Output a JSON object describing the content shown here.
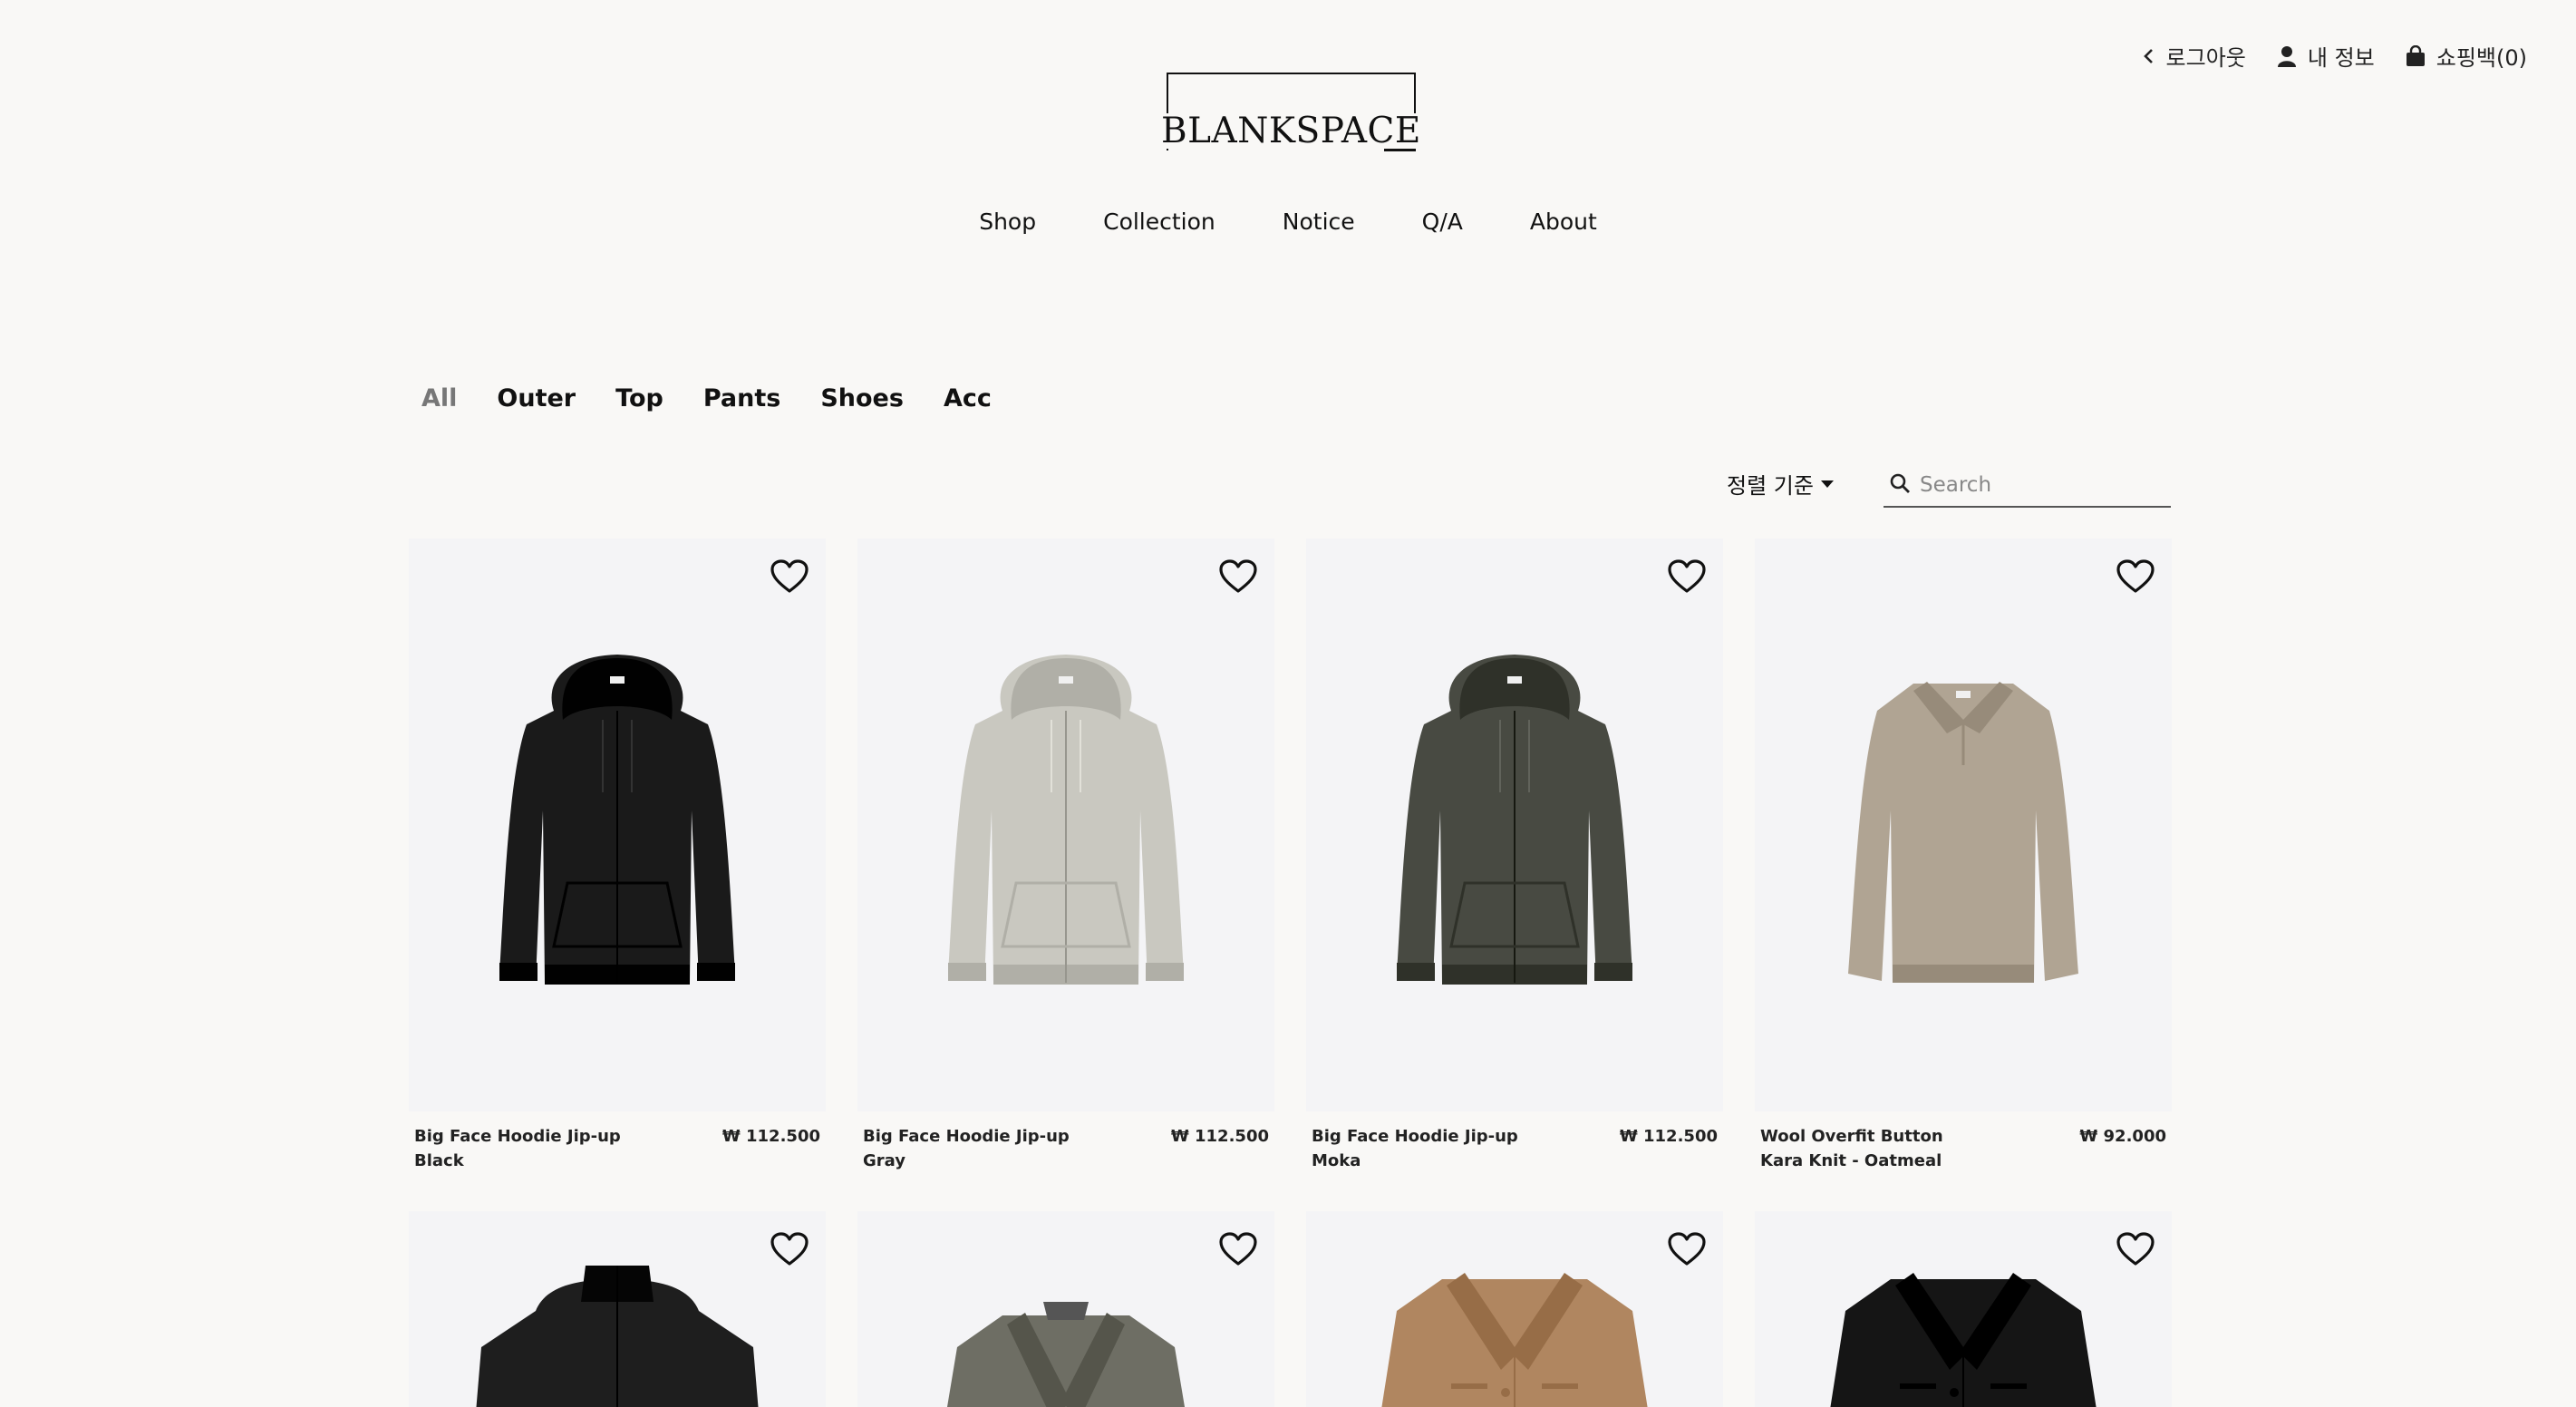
{
  "header": {
    "logout_label": "로그아웃",
    "myinfo_label": "내 정보",
    "cart_label": "쇼핑백(0)"
  },
  "logo": {
    "text": "BLANKSPACE"
  },
  "nav": [
    "Shop",
    "Collection",
    "Notice",
    "Q/A",
    "About"
  ],
  "categories": [
    {
      "label": "All",
      "active": true
    },
    {
      "label": "Outer",
      "active": false
    },
    {
      "label": "Top",
      "active": false
    },
    {
      "label": "Pants",
      "active": false
    },
    {
      "label": "Shoes",
      "active": false
    },
    {
      "label": "Acc",
      "active": false
    }
  ],
  "sort": {
    "label": "정렬 기준"
  },
  "search": {
    "placeholder": "Search",
    "value": ""
  },
  "products": [
    {
      "name": "Big Face Hoodie Jip-up Black",
      "price": "₩ 112.500",
      "color": "#1a1a1a",
      "style": "hoodie"
    },
    {
      "name": "Big Face Hoodie Jip-up Gray",
      "price": "₩ 112.500",
      "color": "#c9c8c0",
      "style": "hoodie"
    },
    {
      "name": "Big Face Hoodie Jip-up Moka",
      "price": "₩ 112.500",
      "color": "#484a42",
      "style": "hoodie"
    },
    {
      "name": "Wool Overfit Button Kara Knit - Oatmeal",
      "price": "₩ 92.000",
      "color": "#b0a493",
      "style": "polo"
    },
    {
      "name": "",
      "price": "",
      "color": "#1e1e1e",
      "style": "puffer"
    },
    {
      "name": "",
      "price": "",
      "color": "#6e6e64",
      "style": "blazer"
    },
    {
      "name": "",
      "price": "",
      "color": "#b08660",
      "style": "coat"
    },
    {
      "name": "",
      "price": "",
      "color": "#151515",
      "style": "coat"
    }
  ],
  "colors": {
    "background": "#f9f8f6",
    "card_background": "#f4f4f6",
    "text": "#111111",
    "active_tab": "#777777"
  },
  "icons": [
    "chevron-left-icon",
    "user-icon",
    "shopping-bag-icon",
    "caret-down-icon",
    "search-icon",
    "heart-icon"
  ]
}
